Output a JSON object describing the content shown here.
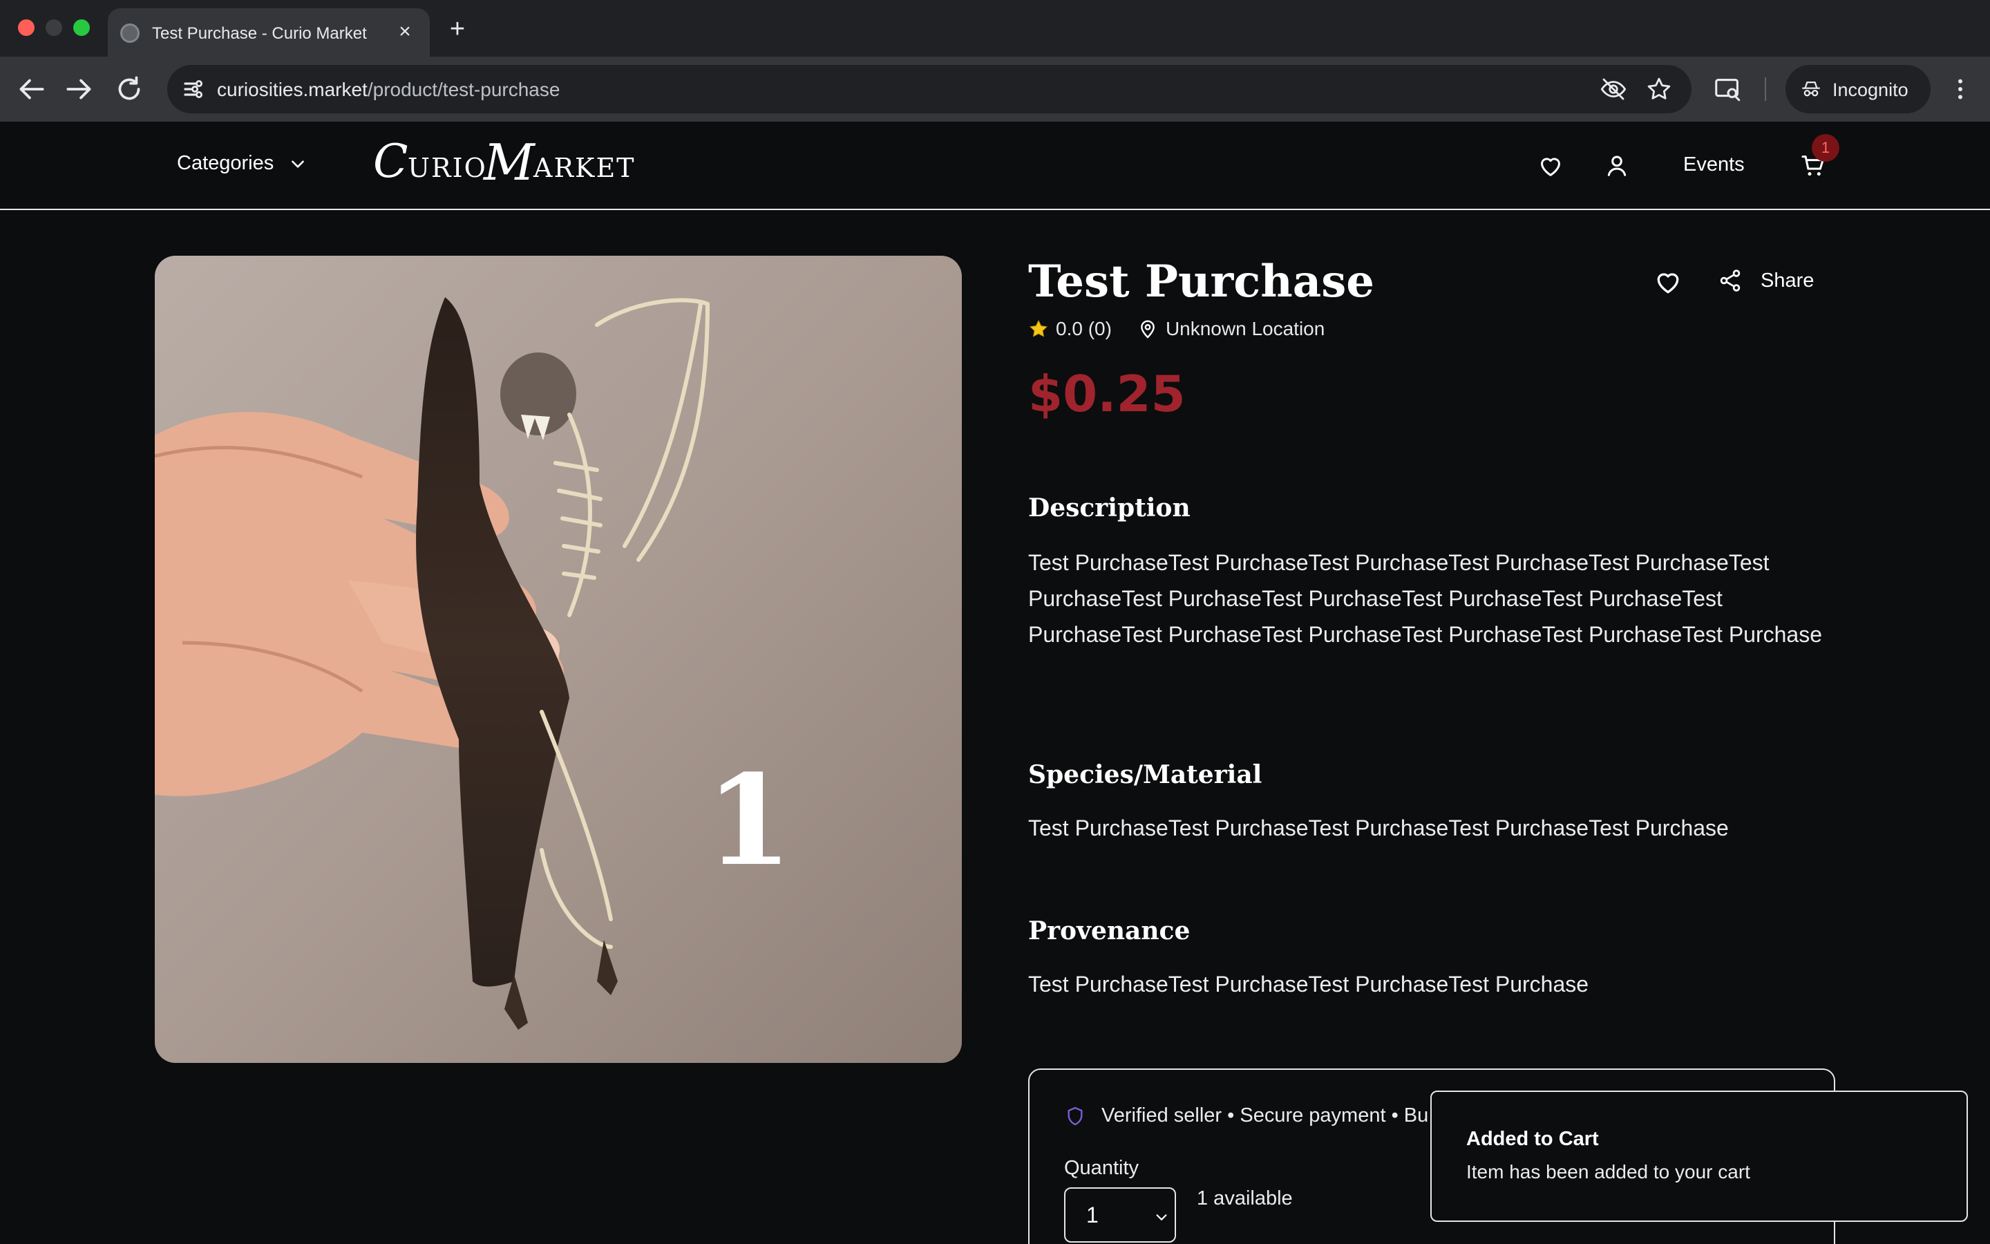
{
  "browser": {
    "tab_title": "Test Purchase - Curio Market",
    "url_host": "curiosities.market",
    "url_path": "/product/test-purchase",
    "incognito_label": "Incognito",
    "icons": [
      "back-icon",
      "forward-icon",
      "reload-icon",
      "site-info-icon",
      "eye-off-icon",
      "star-icon",
      "lens-icon",
      "incognito-icon",
      "menu-icon"
    ]
  },
  "header": {
    "categories_label": "Categories",
    "logo_text": "Curio Market",
    "events_label": "Events",
    "cart_count": "1",
    "icons": [
      "heart-icon",
      "user-icon",
      "cart-icon",
      "chevron-down-icon"
    ]
  },
  "product": {
    "image_overlay_number": "1",
    "title": "Test Purchase",
    "share_label": "Share",
    "rating": "0.0 (0)",
    "location": "Unknown Location",
    "price": "$0.25",
    "sections": {
      "description_heading": "Description",
      "description_text": "Test PurchaseTest PurchaseTest PurchaseTest PurchaseTest PurchaseTest PurchaseTest PurchaseTest PurchaseTest PurchaseTest PurchaseTest PurchaseTest PurchaseTest PurchaseTest PurchaseTest PurchaseTest Purchase",
      "species_heading": "Species/Material",
      "species_text": "Test PurchaseTest PurchaseTest PurchaseTest PurchaseTest Purchase",
      "provenance_heading": "Provenance",
      "provenance_text": "Test PurchaseTest PurchaseTest PurchaseTest Purchase"
    }
  },
  "purchase": {
    "trust_text": "Verified seller • Secure payment • Bu",
    "quantity_label": "Quantity",
    "quantity_value": "1",
    "available_text": "1 available"
  },
  "toast": {
    "title": "Added to Cart",
    "description": "Item has been added to your cart"
  },
  "colors": {
    "accent_price": "#a0242d",
    "cart_badge": "#7a1316",
    "page_bg": "#0c0d0e",
    "chrome_bg": "#202124"
  }
}
